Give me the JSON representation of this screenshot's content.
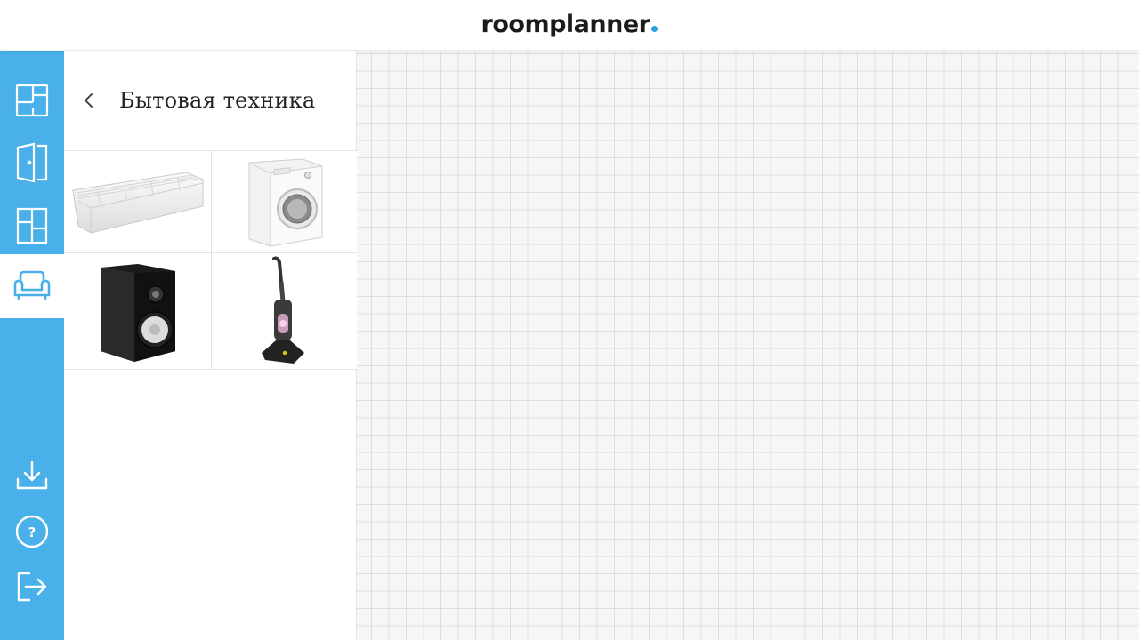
{
  "header": {
    "logo_text": "roomplanner",
    "logo_dot_color": "#2f9fe0"
  },
  "rail": {
    "background": "#4ab0ea",
    "items": [
      {
        "name": "floorplan-icon"
      },
      {
        "name": "door-icon"
      },
      {
        "name": "window-icon"
      },
      {
        "name": "sofa-icon",
        "active": true
      },
      {
        "name": "download-icon"
      },
      {
        "name": "help-icon"
      },
      {
        "name": "logout-icon"
      }
    ]
  },
  "panel": {
    "title": "Бытовая техника",
    "products": [
      {
        "name": "air-conditioner"
      },
      {
        "name": "washing-machine"
      },
      {
        "name": "speaker"
      },
      {
        "name": "vacuum-cleaner"
      }
    ]
  }
}
